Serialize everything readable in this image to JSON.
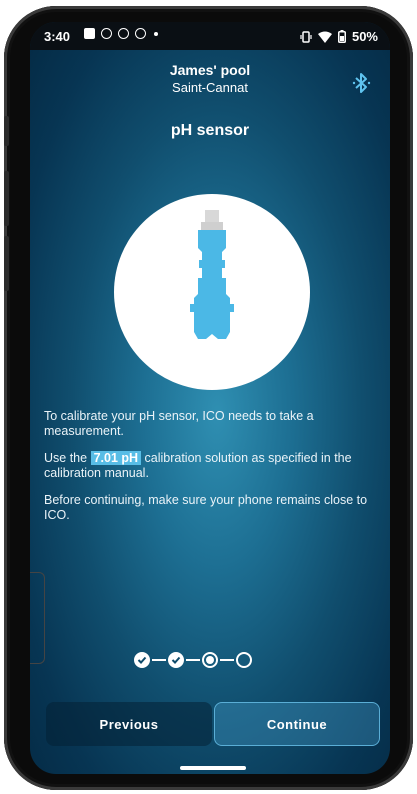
{
  "status_bar": {
    "time": "3:40",
    "battery": "50%",
    "icons": [
      "gallery-icon",
      "cloud-icon",
      "cloud-icon",
      "sync-icon",
      "dot-icon",
      "vibrate-icon",
      "wifi-icon",
      "battery-icon"
    ]
  },
  "header": {
    "pool_name": "James' pool",
    "location": "Saint-Cannat",
    "bluetooth_icon": "bluetooth-icon"
  },
  "page_title": "pH sensor",
  "illustration": "ph-sensor-probe",
  "instructions": {
    "p1": "To calibrate your pH sensor, ICO needs to take a measurement.",
    "p2_before": "Use the ",
    "p2_highlight": "7.01 pH",
    "p2_after": " calibration solution as specified in the calibration manual.",
    "p3": "Before continuing, make sure your phone remains close to ICO."
  },
  "stepper": {
    "steps": [
      "done",
      "done",
      "current",
      "pending"
    ]
  },
  "buttons": {
    "previous": "Previous",
    "continue": "Continue"
  },
  "colors": {
    "accent": "#58bde6",
    "probe": "#4bb8e6",
    "probe_cap": "#d8d8d8",
    "background_dark": "#042a44"
  }
}
